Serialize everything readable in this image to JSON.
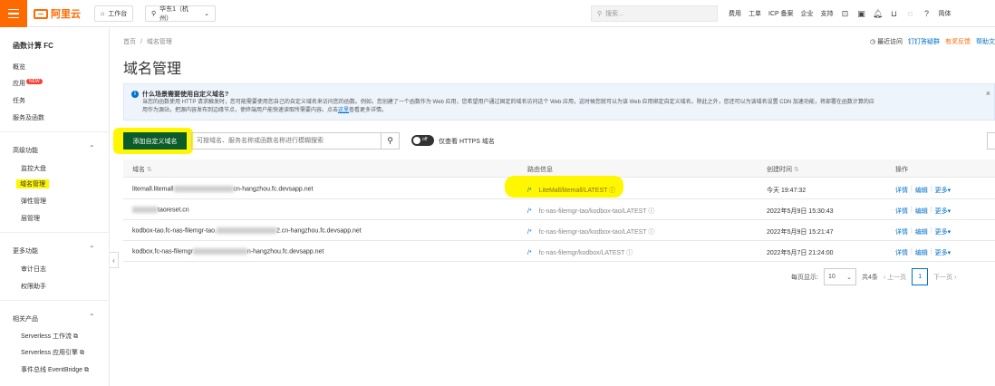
{
  "topbar": {
    "logo": "阿里云",
    "workspace": "工作台",
    "region": "华东1（杭州）",
    "search_placeholder": "搜索...",
    "nav": [
      "费用",
      "工单",
      "ICP 备案",
      "企业",
      "支持"
    ],
    "lang": "简体"
  },
  "sidebar": {
    "title": "函数计算 FC",
    "items": [
      {
        "label": "概览"
      },
      {
        "label": "应用",
        "badge": "NEW"
      },
      {
        "label": "任务"
      },
      {
        "label": "服务及函数"
      }
    ],
    "groups": [
      {
        "label": "高级功能",
        "items": [
          "监控大盘",
          "域名管理",
          "弹性管理",
          "层管理"
        ]
      },
      {
        "label": "更多功能",
        "items": [
          "审计日志",
          "权限助手"
        ]
      },
      {
        "label": "相关产品",
        "items": [
          "Serverless 工作流",
          "Serverless 应用引擎",
          "事件总线 EventBridge"
        ]
      }
    ]
  },
  "main": {
    "breadcrumb": [
      "首页",
      "域名管理"
    ],
    "toplinks": [
      "最近访问",
      "钉钉答疑群",
      "有奖反馈",
      "帮助文"
    ],
    "title": "域名管理",
    "info": {
      "title": "什么场景需要使用自定义域名?",
      "body_1": "当您的函数使用 HTTP 请求触发时，您可能需要使用您自己的自定义域名来访问您的函数。例如，您创建了一个函数作为 Web 应用，您希望用户通过固定的域名访问这个 Web 应用，这时候您就可以为该 Web 应用绑定自定义域名。除此之外，您还可以为该域名设置 CDN 加速功能，将部署在函数计算的应",
      "body_2": "用作为源站，把源内容发布到边缘节点，使终端用户能快速读取所需要内容。点击",
      "link": "这里",
      "body_3": "查看更多详情。"
    },
    "add_button": "添加自定义域名",
    "search_placeholder": "可按域名、服务名称或函数名称进行模糊搜索",
    "toggle_state": "off",
    "toggle_label": "仅查看 HTTPS 域名",
    "table": {
      "headers": [
        "域名",
        "路由信息",
        "创建时间",
        "操作"
      ],
      "rows": [
        {
          "domain_pre": "litemall.litemall",
          "domain_post": "cn-hangzhou.fc.devsapp.net",
          "route": "LiteMall/litemall/LATEST",
          "created": "今天 19:47:32"
        },
        {
          "domain_pre": "",
          "domain_post": "taoreset.cn",
          "route": "fc-nas-filemgr-tao/kodbox-tao/LATEST",
          "created": "2022年5月9日 15:30:43"
        },
        {
          "domain_pre": "kodbox-tao.fc-nas-filemgr-tao.",
          "domain_post": "2.cn-hangzhou.fc.devsapp.net",
          "route": "fc-nas-filemgr-tao/kodbox-tao/LATEST",
          "created": "2022年5月9日 15:21:47"
        },
        {
          "domain_pre": "kodbox.fc-nas-filemgr",
          "domain_post": "n-hangzhou.fc.devsapp.net",
          "route": "fc-nas-filemgr/kodbox/LATEST",
          "created": "2022年5月7日 21:24:00"
        }
      ],
      "ops": {
        "detail": "详情",
        "edit": "编辑",
        "more": "更多"
      }
    },
    "pager": {
      "per_page_label": "每页显示:",
      "per_page": "10",
      "total": "共4条",
      "prev": "上一页",
      "current": "1",
      "next": "下一页"
    }
  }
}
